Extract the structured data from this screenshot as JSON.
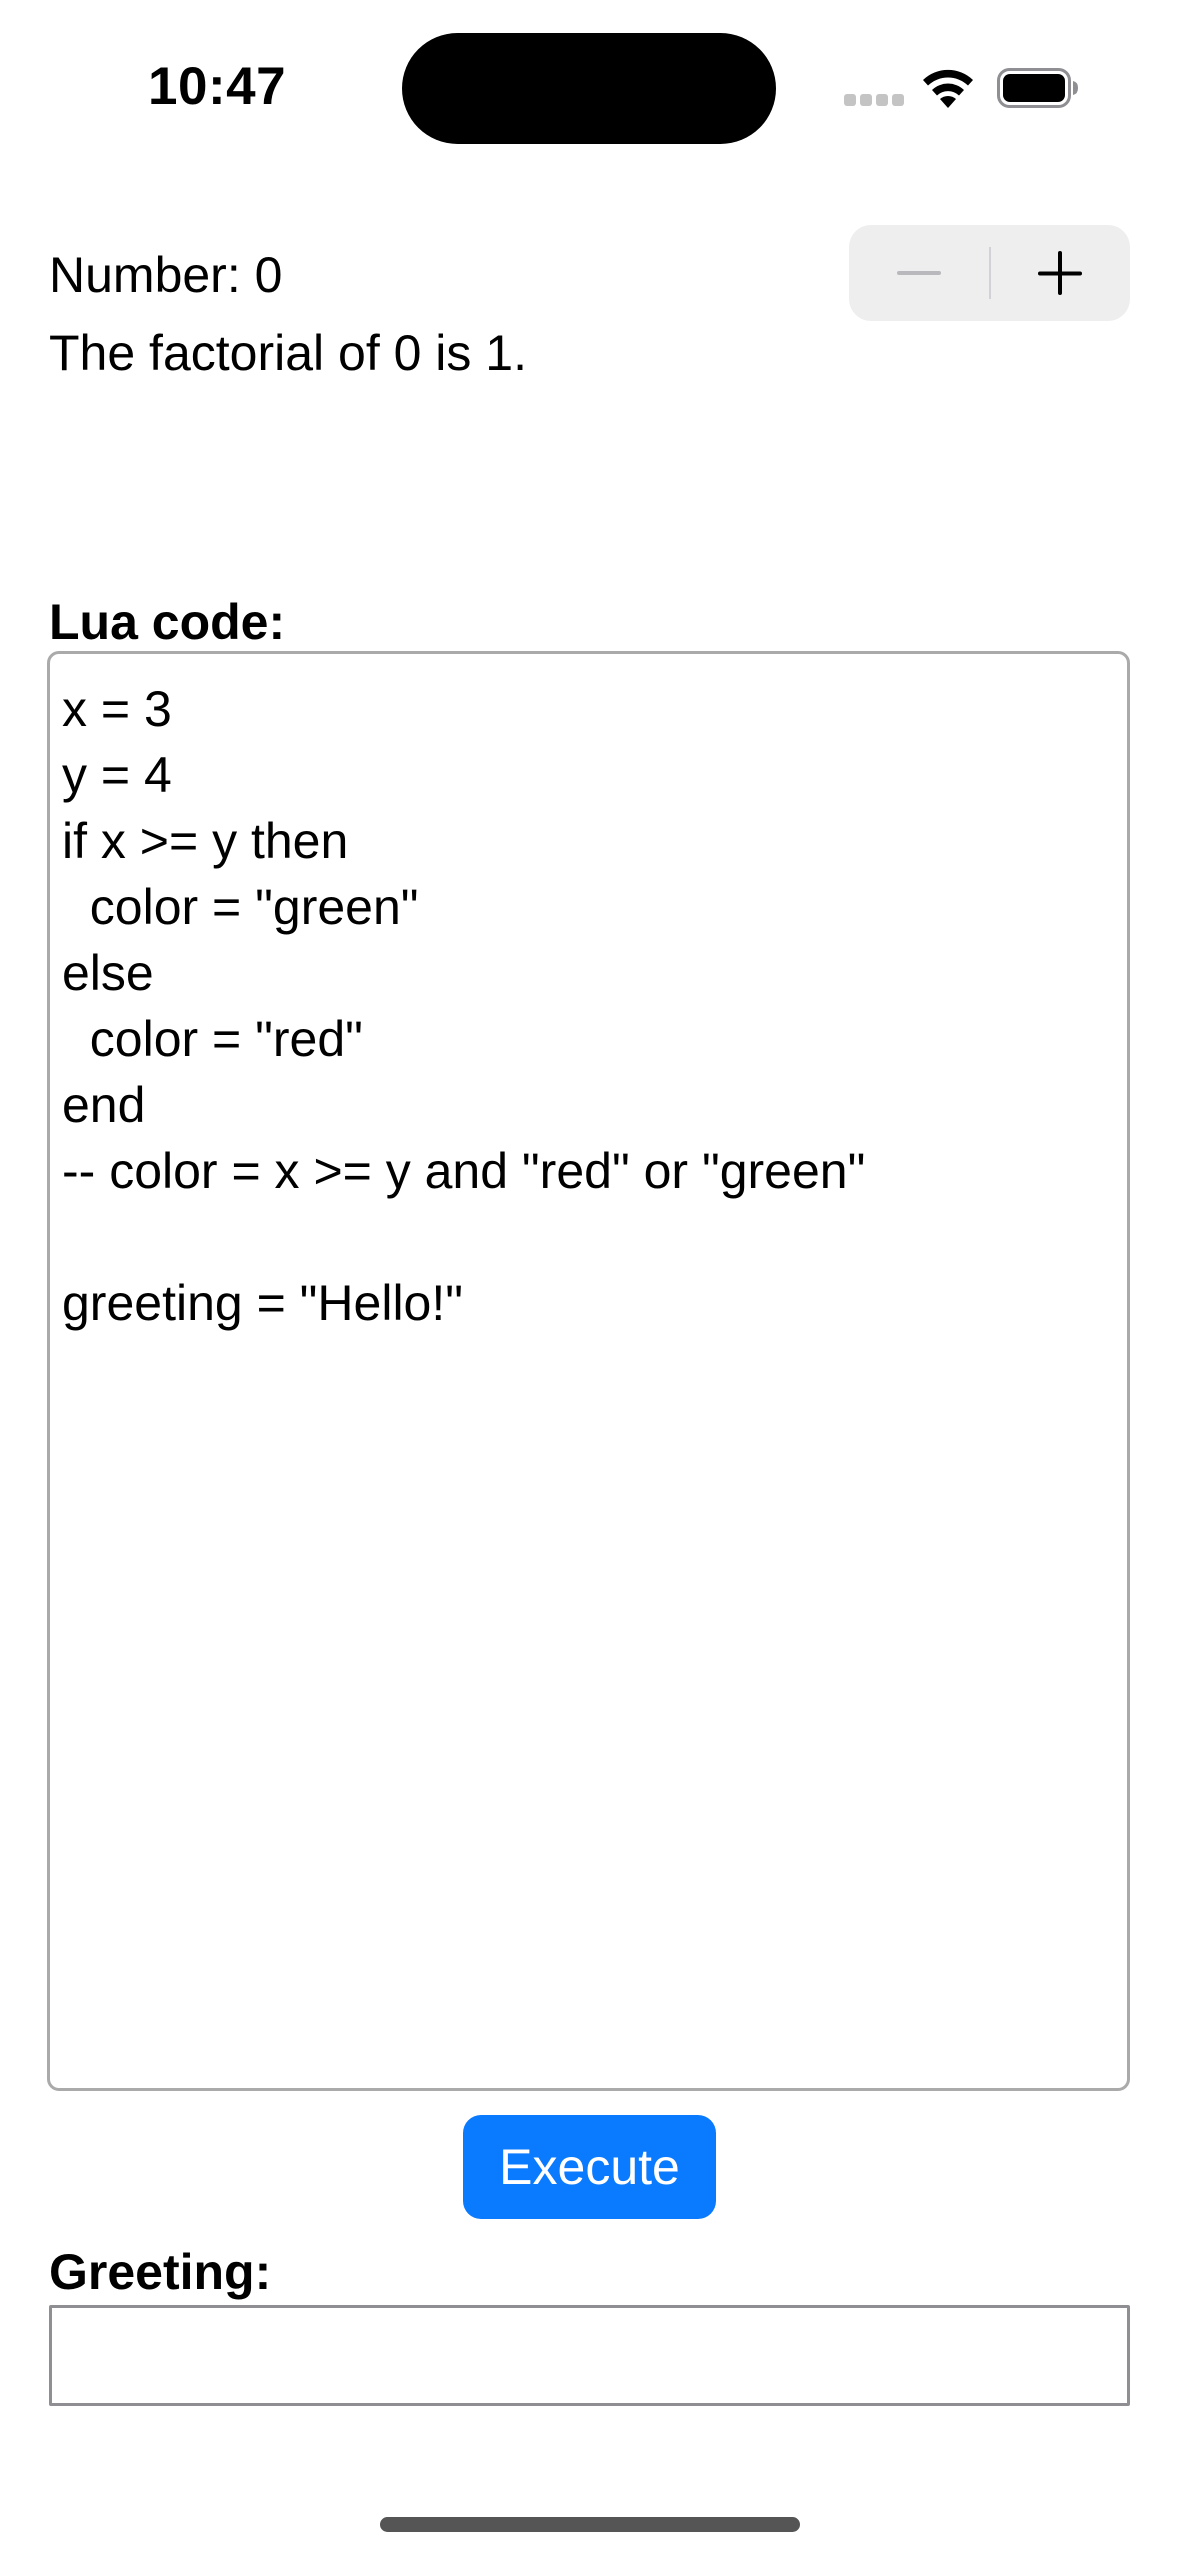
{
  "status_bar": {
    "time": "10:47",
    "icons": [
      "cellular-signal-icon",
      "wifi-icon",
      "battery-icon"
    ]
  },
  "counter": {
    "number_text": "Number: 0",
    "factorial_text": "The factorial of 0 is 1.",
    "stepper_icons": [
      "minus-icon",
      "plus-icon"
    ]
  },
  "lua": {
    "label": "Lua code:",
    "code": "x = 3\ny = 4\nif x >= y then\n  color = \"green\"\nelse\n  color = \"red\"\nend\n-- color = x >= y and \"red\" or \"green\"\n\ngreeting = \"Hello!\"",
    "execute_label": "Execute"
  },
  "greeting": {
    "label": "Greeting:",
    "value": ""
  },
  "colors": {
    "accent": "#0a7aff",
    "stepper_background": "#eeeeef",
    "editor_border": "#aaaaaa",
    "field_border": "#8e8e93"
  }
}
